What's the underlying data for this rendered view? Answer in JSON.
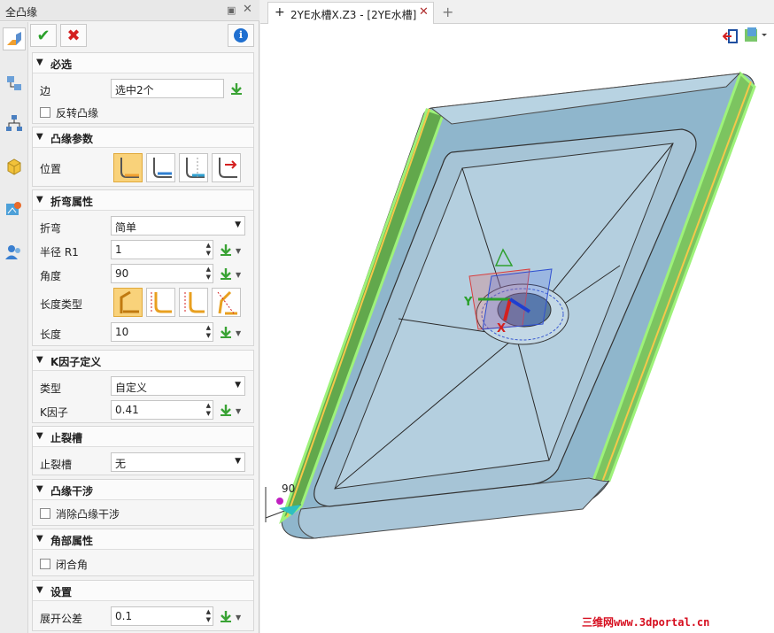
{
  "panel": {
    "title": "全凸缘",
    "pin_glyph": "▣",
    "close_glyph": "✕",
    "toolbar": {
      "ok_glyph": "✔",
      "cancel_glyph": "✖",
      "info_glyph": "i"
    },
    "sections": {
      "required": {
        "title": "必选",
        "edge_label": "边",
        "edge_value": "选中2个",
        "reverse_flange_label": "反转凸缘"
      },
      "flange_params": {
        "title": "凸缘参数",
        "position_label": "位置"
      },
      "bend_props": {
        "title": "折弯属性",
        "bend_label": "折弯",
        "bend_value": "简单",
        "radius_label": "半径 R1",
        "radius_value": "1",
        "angle_label": "角度",
        "angle_value": "90",
        "length_type_label": "长度类型",
        "length_label": "长度",
        "length_value": "10"
      },
      "k_factor": {
        "title": "K因子定义",
        "type_label": "类型",
        "type_value": "自定义",
        "k_label": "K因子",
        "k_value": "0.41"
      },
      "relief": {
        "title": "止裂槽",
        "relief_label": "止裂槽",
        "relief_value": "无"
      },
      "flange_interference": {
        "title": "凸缘干涉",
        "eliminate_label": "消除凸缘干涉"
      },
      "corner_props": {
        "title": "角部属性",
        "closed_corner_label": "闭合角"
      },
      "settings": {
        "title": "设置",
        "unfold_tol_label": "展开公差",
        "unfold_tol_value": "0.1"
      }
    }
  },
  "document_tab": {
    "marker": "+",
    "name": "2YE水槽X.Z3 - [2YE水槽]",
    "close_glyph": "✕",
    "new_tab_glyph": "+"
  },
  "viewport": {
    "triad_y": "Y",
    "triad_x": "X",
    "dim_label": "90"
  },
  "watermark": "三维网www.3dportal.cn",
  "colors": {
    "accent_green": "#7fe05a",
    "sheet_blue": "#a7c5d8",
    "highlight_yellow": "#f5c84a",
    "pick_green": "#3aa335"
  }
}
